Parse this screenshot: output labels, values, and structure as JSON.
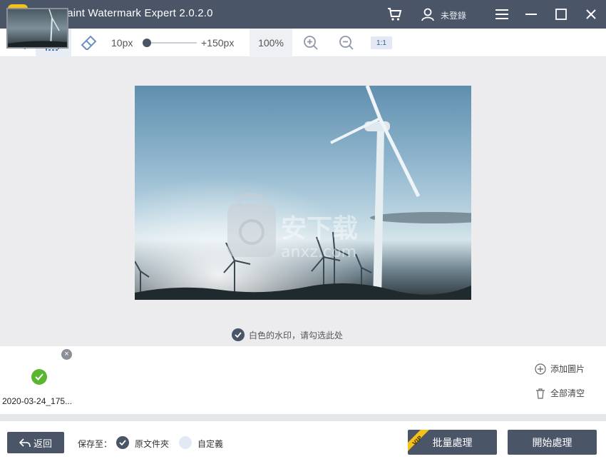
{
  "window": {
    "title": "EasePaint Watermark Expert  2.0.2.0",
    "user_label": "未登錄"
  },
  "toolbar": {
    "min_size": "10px",
    "max_size": "+150px",
    "zoom": "100%",
    "ratio": "1:1"
  },
  "canvas": {
    "hint": "白色的水印，请勾选此处",
    "watermark_text_cn": "安下载",
    "watermark_text_en": "anxz.com"
  },
  "thumbnails": [
    {
      "name": "2020-03-24_175...",
      "selected": true
    }
  ],
  "side_actions": {
    "add_image": "添加圖片",
    "clear_all": "全部清空"
  },
  "bottom": {
    "back": "返回",
    "save_to": "保存至：",
    "option_original": "原文件夾",
    "option_custom": "自定義",
    "batch": "批量處理",
    "vip": "VIP",
    "start": "開始處理"
  },
  "colors": {
    "titlebar": "#4a5568",
    "accent_green": "#5cb531",
    "vip_yellow": "#f6c21a"
  }
}
